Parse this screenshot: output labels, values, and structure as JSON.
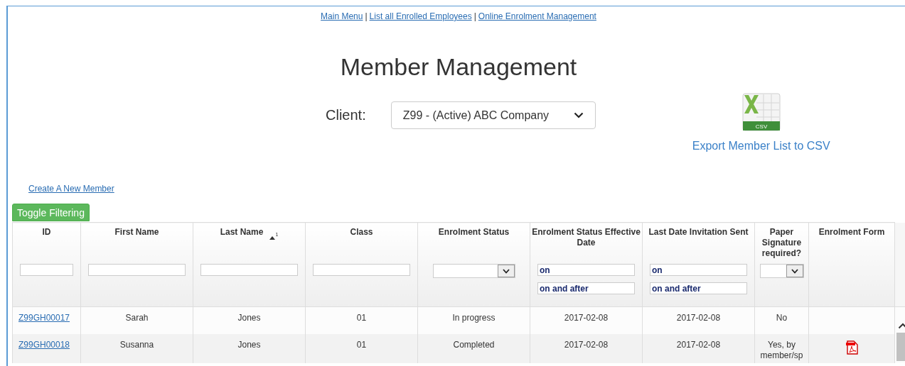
{
  "nav_links": [
    "Main Menu",
    "List all Enrolled Employees",
    "Online Enrolment Management"
  ],
  "nav_separator": "|",
  "title": "Member Management",
  "client": {
    "label": "Client:",
    "value": "Z99 - (Active) ABC Company"
  },
  "export": {
    "badge": "CSV",
    "label": "Export Member List to CSV"
  },
  "create_link": "Create A New Member",
  "toggle_button": "Toggle Filtering",
  "table": {
    "columns": [
      {
        "label": "ID",
        "kind": "text"
      },
      {
        "label": "First Name",
        "kind": "text"
      },
      {
        "label": "Last Name",
        "kind": "text",
        "sort_rank": "1"
      },
      {
        "label": "Class",
        "kind": "text"
      },
      {
        "label": "Enrolment Status",
        "kind": "select"
      },
      {
        "label": "Enrolment Status Effective Date",
        "kind": "date",
        "values": [
          "on",
          "on and after"
        ]
      },
      {
        "label": "Last Date Invitation Sent",
        "kind": "date",
        "values": [
          "on",
          "on and after"
        ]
      },
      {
        "label": "Paper Signature required?",
        "kind": "select"
      },
      {
        "label": "Enrolment Form",
        "kind": "none"
      }
    ],
    "rows": [
      {
        "id": "Z99GH00017",
        "first_name": "Sarah",
        "last_name": "Jones",
        "class": "01",
        "status": "In progress",
        "effective_date": "2017-02-08",
        "invitation_date": "2017-02-08",
        "paper_signature": "No",
        "form": false
      },
      {
        "id": "Z99GH00018",
        "first_name": "Susanna",
        "last_name": "Jones",
        "class": "01",
        "status": "Completed",
        "effective_date": "2017-02-08",
        "invitation_date": "2017-02-08",
        "paper_signature": "Yes, by member/sp",
        "form": true
      }
    ]
  }
}
